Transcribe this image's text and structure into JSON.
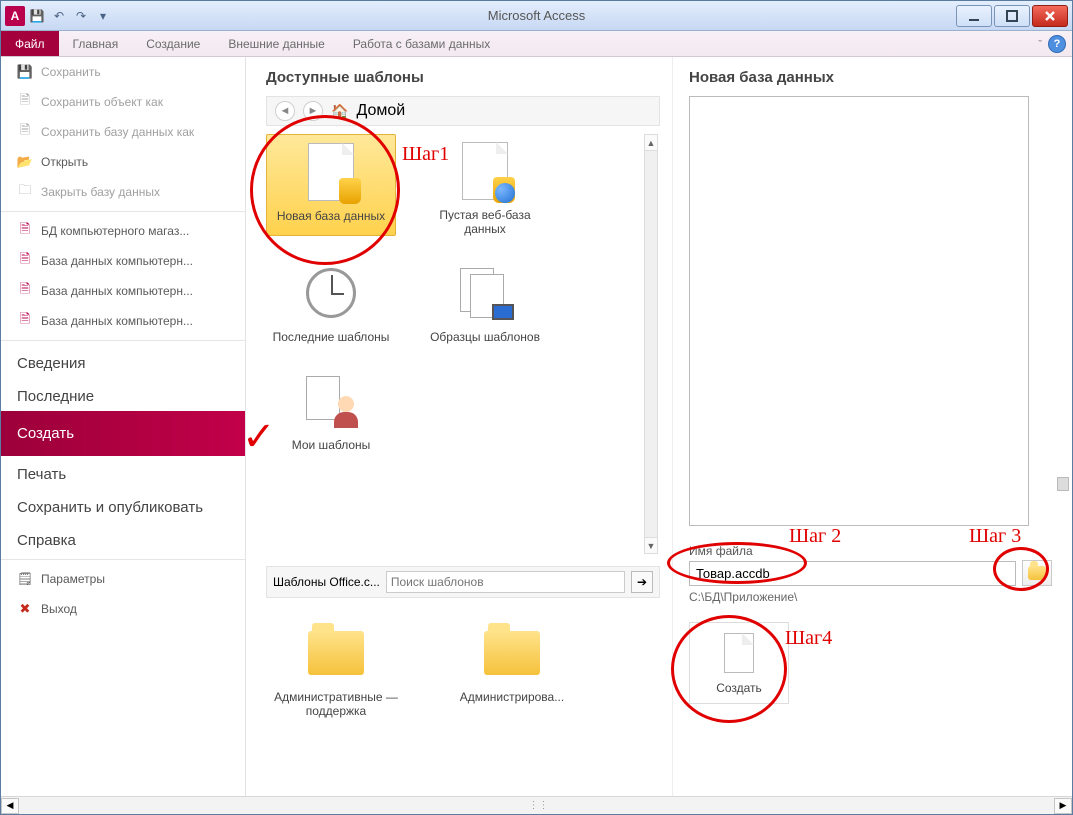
{
  "title": "Microsoft Access",
  "qat": {
    "save": "💾",
    "undo": "↶",
    "redo": "↷",
    "more": "▾"
  },
  "ribbon": {
    "file": "Файл",
    "tabs": [
      "Главная",
      "Создание",
      "Внешние данные",
      "Работа с базами данных"
    ]
  },
  "sidebar": {
    "save": "Сохранить",
    "save_obj": "Сохранить объект как",
    "save_db": "Сохранить базу данных как",
    "open": "Открыть",
    "close_db": "Закрыть базу данных",
    "recent_files": [
      "БД компьютерного магаз...",
      "База данных компьютерн...",
      "База данных компьютерн...",
      "База данных компьютерн..."
    ],
    "info": "Сведения",
    "recent": "Последние",
    "create": "Создать",
    "print": "Печать",
    "save_pub": "Сохранить и опубликовать",
    "help": "Справка",
    "options": "Параметры",
    "exit": "Выход"
  },
  "middle": {
    "title": "Доступные шаблоны",
    "home": "Домой",
    "templates": {
      "new_db": "Новая база данных",
      "web_db": "Пустая веб-база данных",
      "recent_tpl": "Последние шаблоны",
      "sample_tpl": "Образцы шаблонов",
      "my_tpl": "Мои шаблоны"
    },
    "office_label": "Шаблоны Office.c...",
    "search_placeholder": "Поиск шаблонов",
    "folder1": "Административные — поддержка",
    "folder2": "Администрирова..."
  },
  "right": {
    "title": "Новая база данных",
    "file_label": "Имя файла",
    "file_value": "Товар.accdb",
    "path": "C:\\БД\\Приложение\\",
    "create": "Создать"
  },
  "annotations": {
    "step1": "Шаг1",
    "step2": "Шаг 2",
    "step3": "Шаг 3",
    "step4": "Шаг4"
  }
}
